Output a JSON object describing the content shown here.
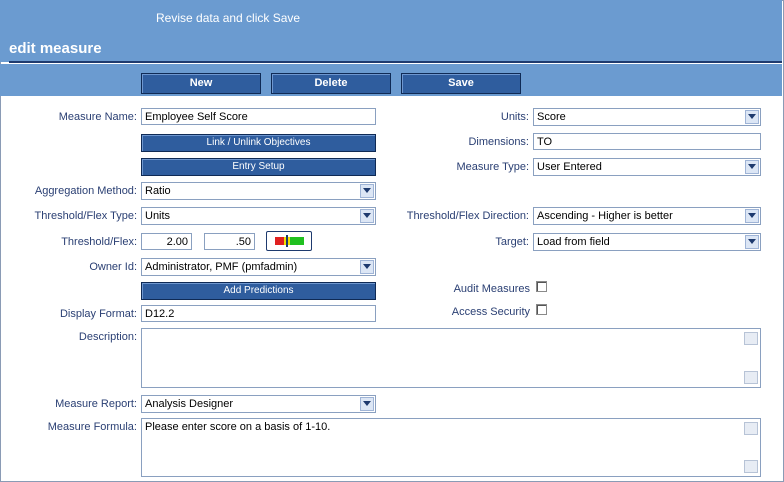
{
  "header": {
    "subtitle": "Revise data and click Save",
    "title": "edit measure"
  },
  "toolbar": {
    "new_label": "New",
    "delete_label": "Delete",
    "save_label": "Save"
  },
  "form": {
    "measure_name": {
      "label": "Measure Name:",
      "value": "Employee Self Score"
    },
    "units": {
      "label": "Units:",
      "value": "Score"
    },
    "link_objectives_label": "Link / Unlink Objectives",
    "dimensions": {
      "label": "Dimensions:",
      "value": "TO"
    },
    "entry_setup_label": "Entry Setup",
    "measure_type": {
      "label": "Measure Type:",
      "value": "User Entered"
    },
    "aggregation_method": {
      "label": "Aggregation Method:",
      "value": "Ratio"
    },
    "threshold_flex_type": {
      "label": "Threshold/Flex Type:",
      "value": "Units"
    },
    "threshold_flex_direction": {
      "label": "Threshold/Flex Direction:",
      "value": "Ascending - Higher is better"
    },
    "threshold_flex": {
      "label": "Threshold/Flex:",
      "value1": "2.00",
      "value2": ".50"
    },
    "target": {
      "label": "Target:",
      "value": "Load from field"
    },
    "owner_id": {
      "label": "Owner Id:",
      "value": "Administrator, PMF (pmfadmin)"
    },
    "add_predictions_label": "Add Predictions",
    "audit_measures_label": "Audit Measures",
    "access_security_label": "Access Security",
    "display_format": {
      "label": "Display Format:",
      "value": "D12.2"
    },
    "description": {
      "label": "Description:",
      "value": ""
    },
    "measure_report": {
      "label": "Measure Report:",
      "value": "Analysis Designer"
    },
    "measure_formula": {
      "label": "Measure Formula:",
      "value": "Please enter score on a basis of 1-10."
    }
  },
  "colors": {
    "header_bg": "#6b9bd0",
    "button_bg": "#2f5d9e",
    "label_text": "#2a3f73",
    "gauge_red": "#e02020",
    "gauge_yellow": "#f0e000",
    "gauge_green": "#20c020"
  }
}
